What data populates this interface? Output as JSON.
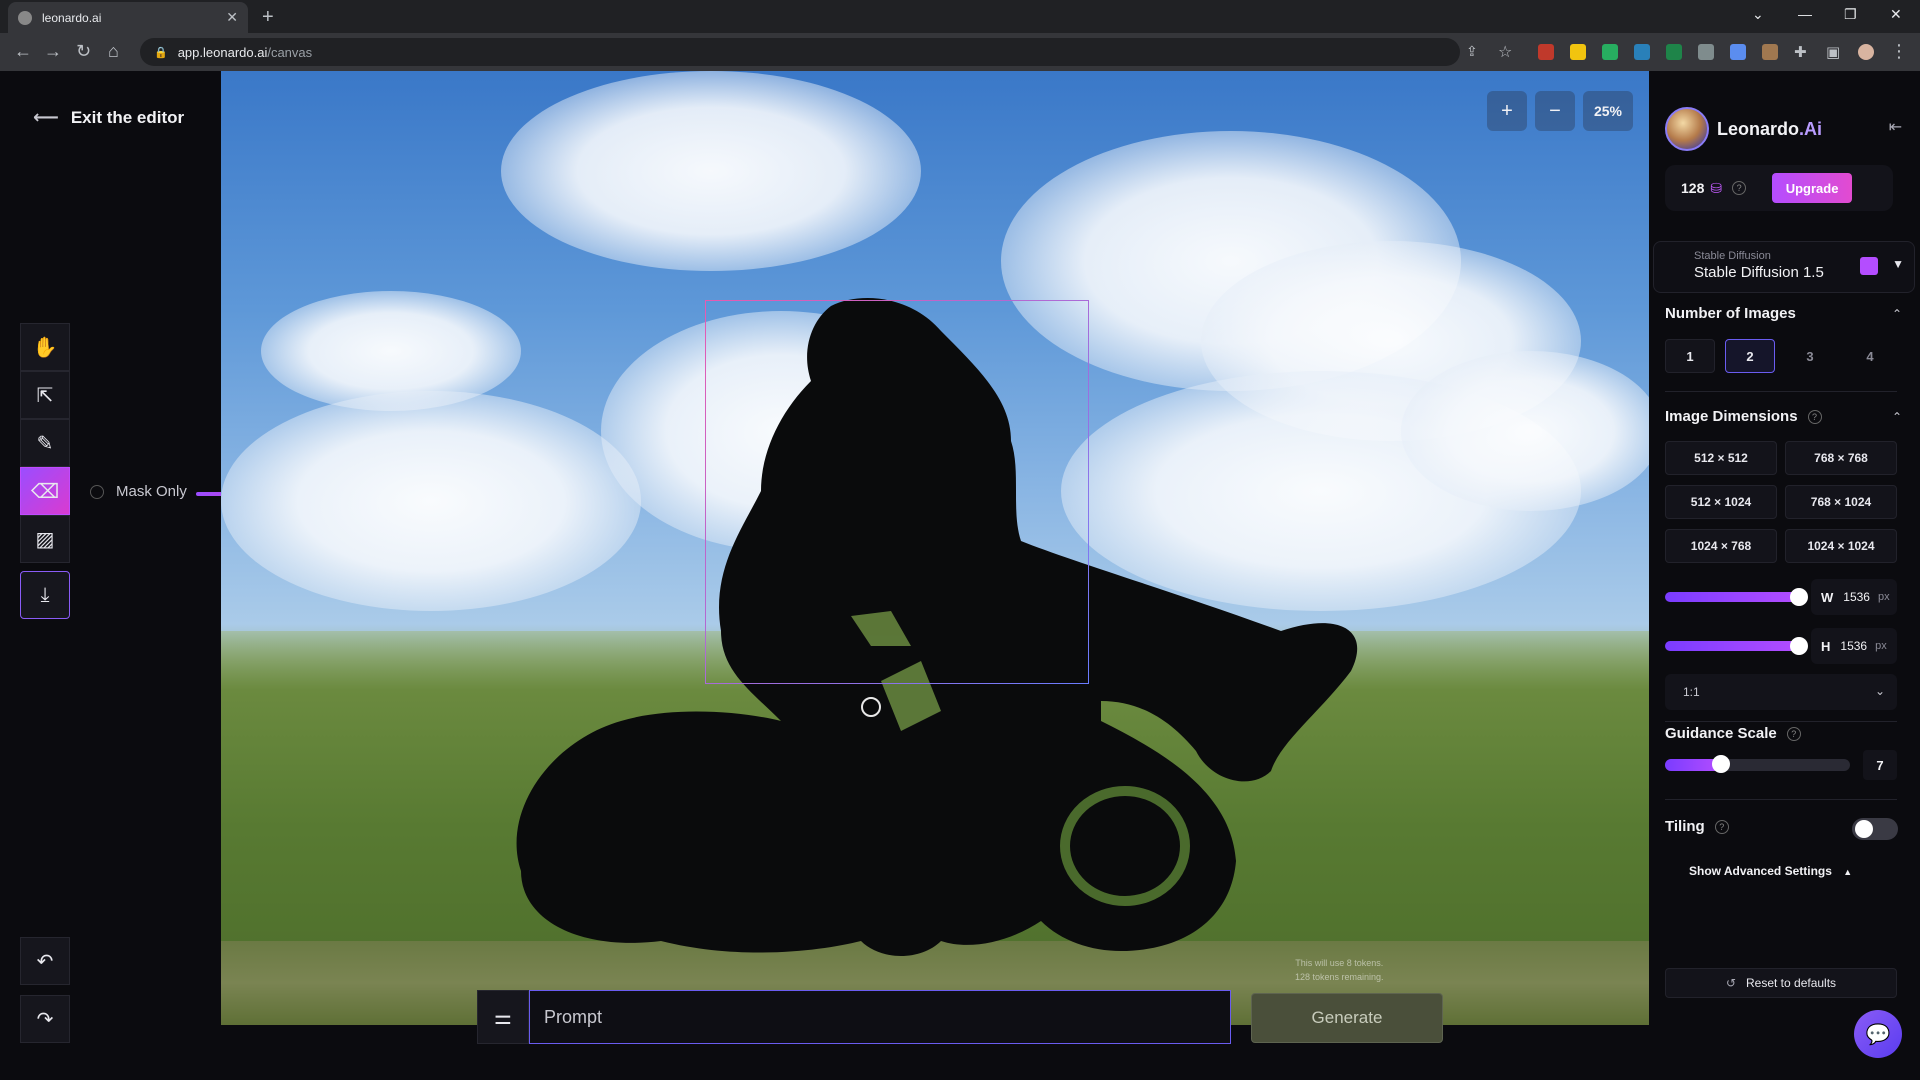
{
  "browser": {
    "tab_title": "leonardo.ai",
    "url_host": "app.leonardo.ai",
    "url_path": "/canvas"
  },
  "editor": {
    "exit_label": "Exit the editor",
    "mask_only_label": "Mask Only",
    "brush_size_fraction": 0.55,
    "tools": [
      {
        "name": "hand-tool",
        "icon": "hand-icon",
        "active": false
      },
      {
        "name": "select-tool",
        "icon": "select-icon",
        "active": false
      },
      {
        "name": "draw-mask-tool",
        "icon": "mask-brush-icon",
        "active": false
      },
      {
        "name": "erase-tool",
        "icon": "eraser-icon",
        "active": true
      },
      {
        "name": "image-upload-tool",
        "icon": "image-icon",
        "active": false
      },
      {
        "name": "download-tool",
        "icon": "download-icon",
        "active": false
      }
    ],
    "zoom": {
      "plus": "+",
      "minus": "−",
      "percent": "25%"
    },
    "token_note_line1": "This will use 8 tokens.",
    "token_note_line2": "128 tokens remaining.",
    "prompt_placeholder": "Prompt",
    "generate_label": "Generate"
  },
  "panel": {
    "brand": "Leonardo",
    "brand_suffix": ".Ai",
    "tokens": "128",
    "upgrade_label": "Upgrade",
    "model_subtitle": "Stable Diffusion",
    "model_name": "Stable Diffusion 1.5",
    "number_of_images_title": "Number of Images",
    "number_options": [
      "1",
      "2",
      "3",
      "4"
    ],
    "number_selected": "2",
    "dimensions_title": "Image Dimensions",
    "dimension_options": [
      "512 × 512",
      "768 × 768",
      "512 × 1024",
      "768 × 1024",
      "1024 × 768",
      "1024 × 1024"
    ],
    "width_label": "W",
    "width_value": "1536",
    "height_label": "H",
    "height_value": "1536",
    "unit": "px",
    "aspect_ratio": "1:1",
    "guidance_title": "Guidance Scale",
    "guidance_value": "7",
    "guidance_fraction": 0.3,
    "tiling_title": "Tiling",
    "tiling_on": false,
    "advanced_label": "Show Advanced Settings",
    "reset_label": "Reset to defaults"
  },
  "colors": {
    "accent_purple": "#b44dff",
    "accent_pink": "#e24bd0",
    "selection_border": "#6a5cf0"
  }
}
